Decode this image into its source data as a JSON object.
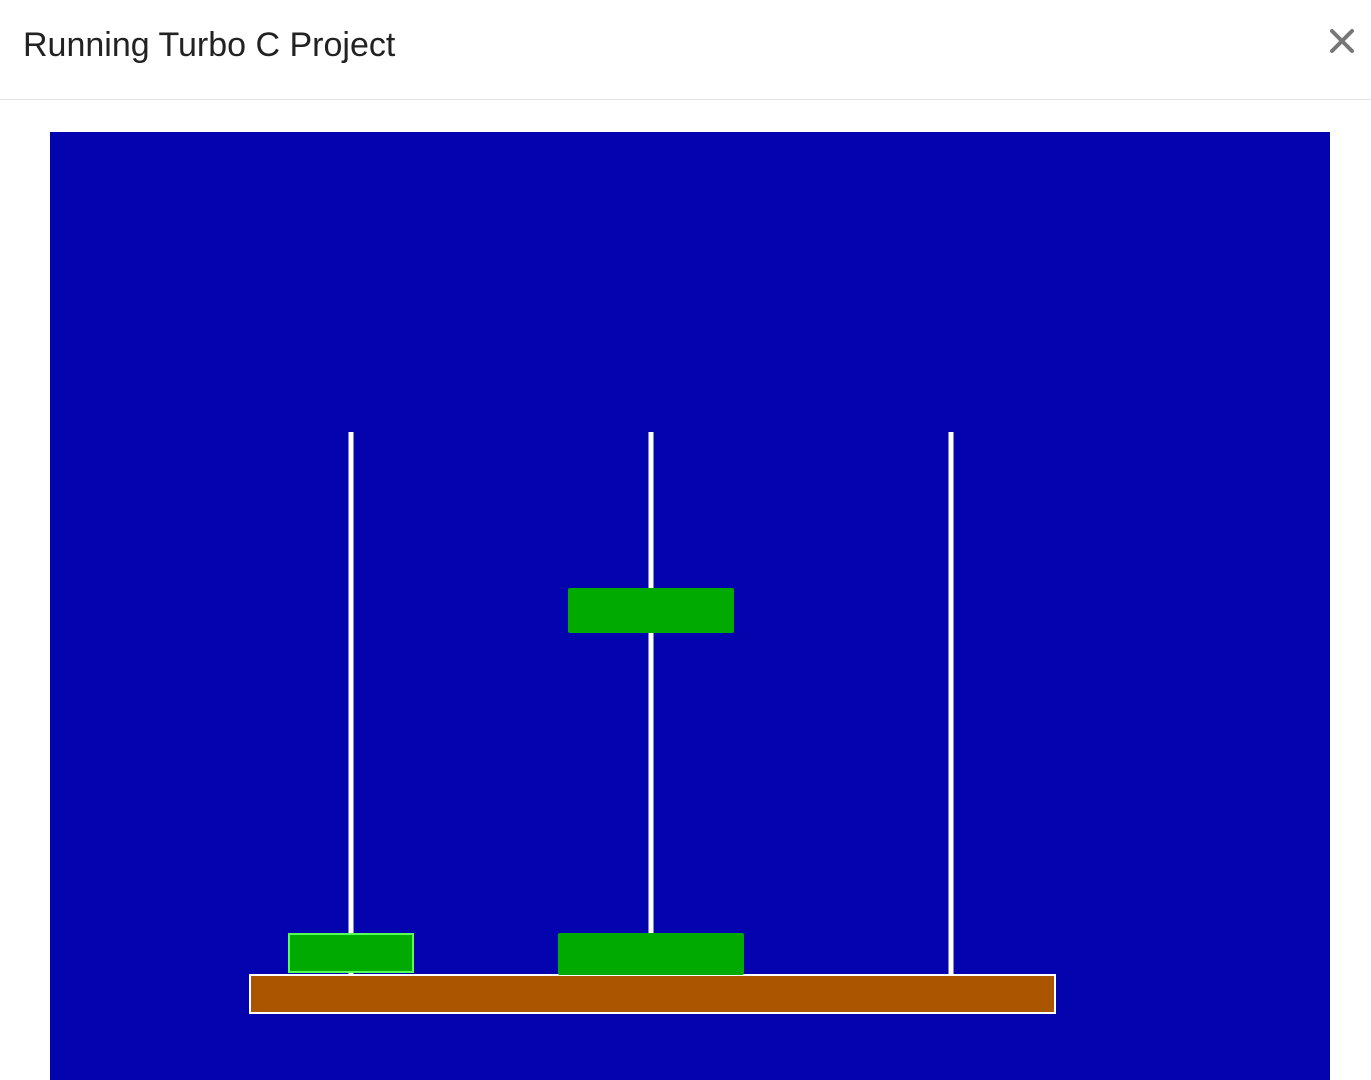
{
  "dialog": {
    "title": "Running Turbo C Project",
    "close_icon": "close-icon"
  },
  "program_screen": {
    "background_color": "#0404AE",
    "pegs": {
      "count": 3,
      "color": "#FFFFFF"
    },
    "base": {
      "color": "#AA5500",
      "outline_color": "#FFFFFF"
    },
    "disks": {
      "color": "#00AA00",
      "outline_color": "#55FF55",
      "items": [
        {
          "peg": 1,
          "stack_position": 1,
          "relative_width": 2
        },
        {
          "peg": 2,
          "stack_position": 1,
          "relative_width": 3
        },
        {
          "peg": 2,
          "moving": true,
          "relative_width": 3
        }
      ]
    }
  }
}
